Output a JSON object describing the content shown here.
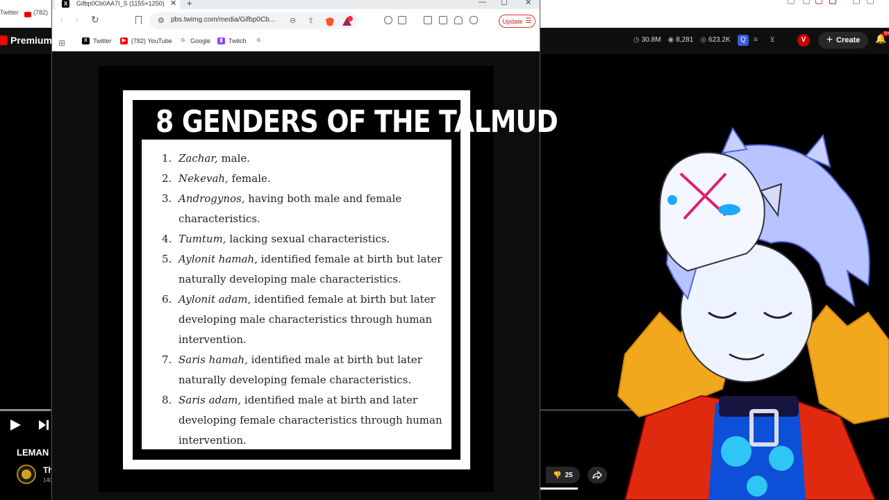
{
  "background_youtube": {
    "bookmarks_partial": [
      "Twitter",
      "(782)"
    ],
    "logo_text": "Premium",
    "stats": {
      "views": "30.8M",
      "likes": "8,281",
      "third": "623.2K"
    },
    "create_label": "Create",
    "vip_badge": "V",
    "notif_count": "9+",
    "progress_fraction": 0.057,
    "video_title_partial": "LEMAN",
    "channel_partial": "Th",
    "subs_partial": "140",
    "dislike_count": "25"
  },
  "browser": {
    "tab_title": "Gifbp0Cb0AA7I_S (1155×1250)",
    "url": "pbs.twimg.com/media/Gifbp0Cb...",
    "update_label": "Update",
    "bookmarks": [
      {
        "label": "Twitter",
        "icon": "x-logo-icon",
        "color": "#000000"
      },
      {
        "label": "(782) YouTube",
        "icon": "youtube-icon",
        "color": "#ff0000"
      },
      {
        "label": "Google",
        "icon": "google-icon",
        "color": "#4285f4"
      },
      {
        "label": "Twitch",
        "icon": "twitch-icon",
        "color": "#9146ff"
      },
      {
        "label": "",
        "icon": "google-icon",
        "color": "#4285f4"
      }
    ]
  },
  "poster": {
    "title": "8 GENDERS OF THE TALMUD",
    "items": [
      {
        "num": "1.",
        "term": "Zachar,",
        "desc": " male."
      },
      {
        "num": "2.",
        "term": "Nekevah,",
        "desc": " female."
      },
      {
        "num": "3.",
        "term": "Androgynos,",
        "desc": " having both male and female characteristics."
      },
      {
        "num": "4.",
        "term": "Tumtum,",
        "desc": " lacking sexual characteristics."
      },
      {
        "num": "5.",
        "term": "Aylonit hamah,",
        "desc": " identified female at birth but later naturally developing male characteristics."
      },
      {
        "num": "6.",
        "term": "Aylonit adam,",
        "desc": " identified female at birth but later developing male characteristics through human intervention."
      },
      {
        "num": "7.",
        "term": "Saris hamah,",
        "desc": " identified male at birth but later naturally developing female characteristics."
      },
      {
        "num": "8.",
        "term": "Saris adam,",
        "desc": " identified male at birth and later developing female characteristics through human intervention."
      }
    ]
  },
  "colors": {
    "youtube_red": "#ff0000",
    "brave_orange": "#fb542b",
    "update_red": "#cc2222"
  }
}
